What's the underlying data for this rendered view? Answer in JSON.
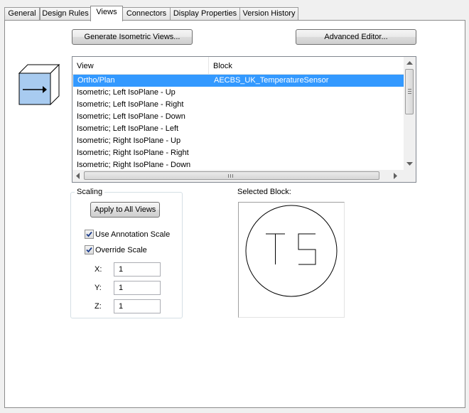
{
  "tabs": [
    {
      "label": "General"
    },
    {
      "label": "Design Rules"
    },
    {
      "label": "Views"
    },
    {
      "label": "Connectors"
    },
    {
      "label": "Display Properties"
    },
    {
      "label": "Version History"
    }
  ],
  "active_tab": "Views",
  "buttons": {
    "generate": "Generate Isometric Views...",
    "advanced": "Advanced Editor...",
    "apply_all": "Apply to All Views"
  },
  "view_icon": "isometric-cube-arrow-icon",
  "list": {
    "headers": {
      "view": "View",
      "block": "Block"
    },
    "rows": [
      {
        "view": "Ortho/Plan",
        "block": "AECBS_UK_TemperatureSensor",
        "selected": true
      },
      {
        "view": "Isometric; Left IsoPlane - Up",
        "block": ""
      },
      {
        "view": "Isometric; Left IsoPlane - Right",
        "block": ""
      },
      {
        "view": "Isometric; Left IsoPlane - Down",
        "block": ""
      },
      {
        "view": "Isometric; Left IsoPlane - Left",
        "block": ""
      },
      {
        "view": "Isometric; Right IsoPlane - Up",
        "block": ""
      },
      {
        "view": "Isometric; Right IsoPlane - Right",
        "block": ""
      },
      {
        "view": "Isometric; Right IsoPlane - Down",
        "block": ""
      }
    ]
  },
  "scaling": {
    "title": "Scaling",
    "use_annotation_label": "Use Annotation Scale",
    "use_annotation_checked": true,
    "override_label": "Override Scale",
    "override_checked": true,
    "x_label": "X:",
    "x_value": "1",
    "y_label": "Y:",
    "y_value": "1",
    "z_label": "Z:",
    "z_value": "1"
  },
  "selected_block": {
    "label": "Selected Block:",
    "symbol_text": "TS"
  },
  "colors": {
    "selection": "#3399ff",
    "icon_fill": "#a8cbf0"
  }
}
